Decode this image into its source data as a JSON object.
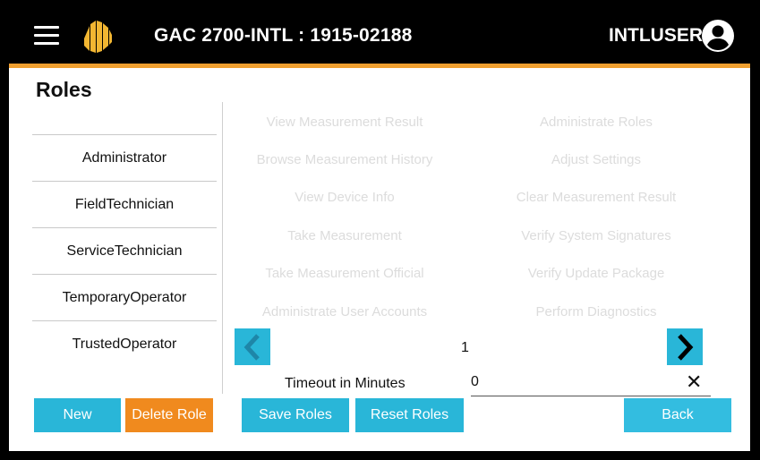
{
  "header": {
    "title": "GAC 2700-INTL : 1915-02188",
    "user": "INTLUSER",
    "colors": {
      "background": "#000000",
      "accent": "#f0a030",
      "logo": "#f2b632"
    },
    "icons": {
      "menu": "hamburger-menu-icon",
      "logo": "gac-logo-icon",
      "avatar": "account-circle-icon"
    }
  },
  "page": {
    "title": "Roles"
  },
  "roles": [
    {
      "label": "Administrator"
    },
    {
      "label": "FieldTechnician"
    },
    {
      "label": "ServiceTechnician"
    },
    {
      "label": "TemporaryOperator"
    },
    {
      "label": "TrustedOperator"
    }
  ],
  "permissions": {
    "left": [
      "View Measurement Result",
      "Browse Measurement History",
      "View Device Info",
      "Take Measurement",
      "Take Measurement Official",
      "Administrate User Accounts"
    ],
    "right": [
      "Administrate Roles",
      "Adjust Settings",
      "Clear Measurement Result",
      "Verify System Signatures",
      "Verify Update Package",
      "Perform Diagnostics"
    ]
  },
  "pagination": {
    "current": "1",
    "prev_icon": "chevron-left-icon",
    "next_icon": "chevron-right-icon"
  },
  "timeout": {
    "label": "Timeout in Minutes",
    "value": "0",
    "clear": "✕"
  },
  "buttons": {
    "new": "New",
    "delete": "Delete Role",
    "save": "Save Roles",
    "reset": "Reset Roles",
    "back": "Back"
  },
  "colors": {
    "primary_button": "#29b6d8",
    "danger_button": "#f08a1e",
    "disabled_text": "#dcdcdc"
  }
}
